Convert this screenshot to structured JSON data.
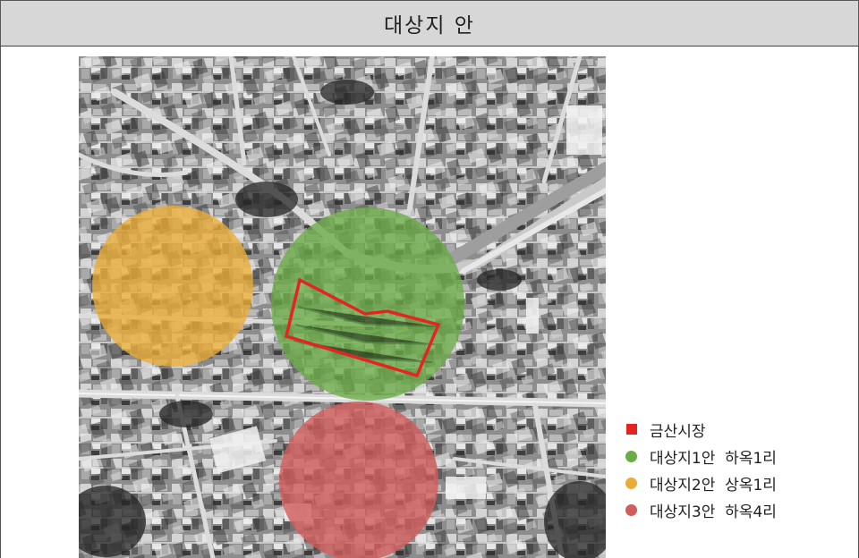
{
  "header": {
    "title": "대상지 안"
  },
  "map": {
    "image": "aerial-photo-grayscale",
    "overlays": [
      {
        "name": "candidate-1",
        "color": "#6aac46"
      },
      {
        "name": "candidate-2",
        "color": "#eaad34"
      },
      {
        "name": "candidate-3",
        "color": "#d25b5b"
      },
      {
        "name": "market-boundary",
        "color": "#e52421"
      }
    ]
  },
  "legend": {
    "items": [
      {
        "label": "금산시장",
        "color": "#e52421",
        "shape": "square"
      },
      {
        "label": "대상지1안  하옥1리",
        "color": "#6aac46",
        "shape": "circle"
      },
      {
        "label": "대상지2안  상옥1리",
        "color": "#eaad34",
        "shape": "circle"
      },
      {
        "label": "대상지3안  하옥4리",
        "color": "#d25b5b",
        "shape": "circle"
      }
    ]
  }
}
